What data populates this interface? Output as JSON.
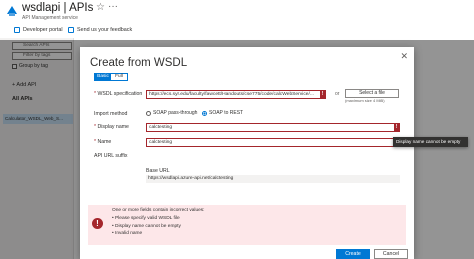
{
  "header": {
    "title": "wsdlapi | APIs",
    "subtitle": "API Management service",
    "favorite_glyph": "☆",
    "more_glyph": "···",
    "logo_icon": "api-management-icon"
  },
  "commands": {
    "developer_portal": "Developer portal",
    "feedback": "Send us your feedback"
  },
  "sidebar": {
    "search_placeholder": "Search APIs",
    "filter_placeholder": "Filter by tags",
    "group_by_tag": "Group by tag",
    "add_api": "+ Add API",
    "all_apis": "All APIs",
    "api_item": "Calculator_WSDL_Web_S..."
  },
  "dialog": {
    "title": "Create from WSDL",
    "close_glyph": "✕",
    "toggle": {
      "basic": "Basic",
      "full": "Full"
    },
    "wsdl_spec_label": "WSDL specification",
    "wsdl_spec_value": "https://ecs.syr.edu/faculty/fawcett/Handouts/cse775/code/calcWebService/...",
    "or_text": "or",
    "select_file": "Select a file",
    "max_size": "(maximum size 4 MiB)",
    "import_method_label": "Import method",
    "import_options": [
      "SOAP pass-through",
      "SOAP to REST"
    ],
    "display_name_label": "Display name",
    "display_name_value": "calctesting",
    "name_label": "Name",
    "name_value": "calctesting",
    "api_url_suffix_label": "API URL suffix",
    "base_url_label": "Base URL",
    "base_url_value": "https://wsdlapi.azure-api.net/calctesting",
    "error_mark": "!",
    "tooltip": "Display name cannot be empty",
    "error_box": {
      "icon": "!",
      "heading": "One or more fields contain incorrect values:",
      "items": [
        "Please specify valid WSDL file",
        "Display name cannot be empty",
        "Invalid name"
      ]
    },
    "create_label": "Create",
    "cancel_label": "Cancel"
  },
  "colors": {
    "accent": "#0078d4",
    "error": "#a4262c",
    "error_bg": "#fde7e9"
  }
}
